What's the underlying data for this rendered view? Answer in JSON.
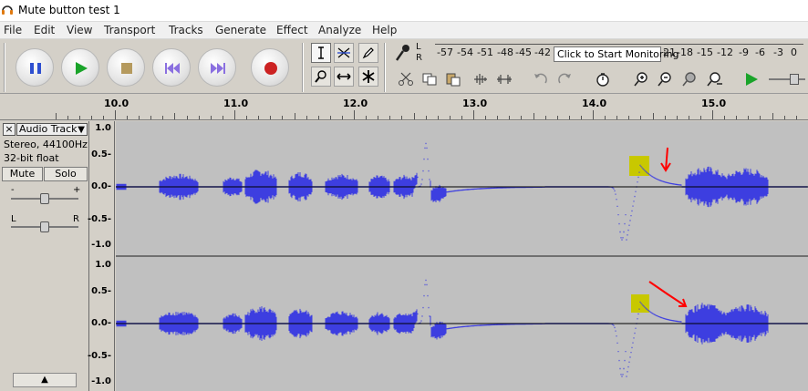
{
  "window": {
    "title": "Mute button test 1",
    "icon": "audacity-icon"
  },
  "menu": [
    "File",
    "Edit",
    "View",
    "Transport",
    "Tracks",
    "Generate",
    "Effect",
    "Analyze",
    "Help"
  ],
  "transport": {
    "buttons": [
      "pause",
      "play",
      "stop",
      "skip-to-start",
      "skip-to-end",
      "record"
    ]
  },
  "meter": {
    "levels": [
      "-57",
      "-54",
      "-51",
      "-48",
      "-45",
      "-42",
      "-3"
    ],
    "levels_right": [
      "21",
      "-18",
      "-15",
      "-12",
      "-9",
      "-6",
      "-3",
      "0"
    ],
    "tooltip": "Click to Start Monitoring",
    "label_l": "L",
    "label_r": "R"
  },
  "ruler": {
    "labels": [
      "10.0",
      "11.0",
      "12.0",
      "13.0",
      "14.0",
      "15.0"
    ]
  },
  "track": {
    "name": "Audio Track",
    "format": "Stereo, 44100Hz",
    "bitdepth": "32-bit float",
    "mute_label": "Mute",
    "solo_label": "Solo",
    "gain_minus": "-",
    "gain_plus": "+",
    "pan_left": "L",
    "pan_right": "R",
    "close": "×",
    "collapse": "▲"
  },
  "scale": {
    "labels": [
      "1.0",
      "0.5-",
      "0.0-",
      "-0.5-",
      "-1.0"
    ]
  },
  "colors": {
    "waveform": "#3d3ee0",
    "background": "#c0c0c0",
    "highlight": "#c8c800",
    "annotation": "#ff0000"
  }
}
